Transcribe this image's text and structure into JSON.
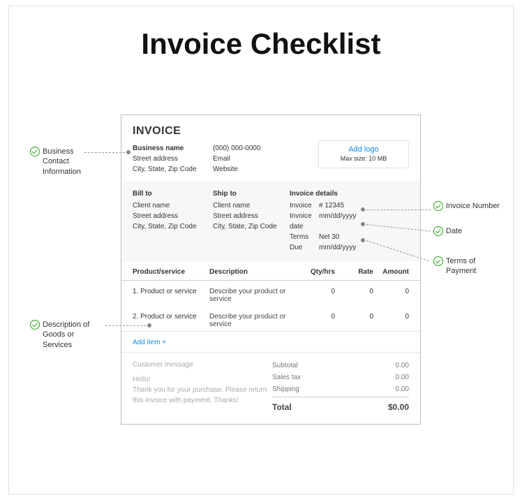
{
  "title": "Invoice Checklist",
  "invoice": {
    "heading": "INVOICE",
    "business": {
      "name": "Business name",
      "street": "Street address",
      "city": "City, State, Zip Code",
      "phone": "(000) 000-0000",
      "email": "Email",
      "website": "Website"
    },
    "logo": {
      "add_label": "Add logo",
      "max_label": "Max size: 10 MB"
    },
    "billto": {
      "label": "Bill to",
      "name": "Client name",
      "street": "Street address",
      "city": "City, State, Zip Code"
    },
    "shipto": {
      "label": "Ship to",
      "name": "Client name",
      "street": "Street address",
      "city": "City, State, Zip Code"
    },
    "details": {
      "label": "Invoice details",
      "invoice_k": "Invoice",
      "invoice_v": "# 12345",
      "date_k": "Invoice date",
      "date_v": "mm/dd/yyyy",
      "terms_k": "Terms",
      "terms_v": "Net 30",
      "due_k": "Due",
      "due_v": "mm/dd/yyyy"
    },
    "columns": {
      "ps": "Product/service",
      "desc": "Description",
      "qty": "Qty/hrs",
      "rate": "Rate",
      "amt": "Amount"
    },
    "rows": [
      {
        "ps": "1. Product or service",
        "desc": "Describe your product or service",
        "qty": "0",
        "rate": "0",
        "amt": "0"
      },
      {
        "ps": "2. Product or service",
        "desc": "Describe your product or service",
        "qty": "0",
        "rate": "0",
        "amt": "0"
      }
    ],
    "add_item": "Add item +",
    "customer_message": {
      "title": "Customer message",
      "body": "Hello!\nThank you for your purchase. Please return this invoice with payment. Thanks!"
    },
    "totals": {
      "subtotal_k": "Subtotal",
      "subtotal_v": "0.00",
      "tax_k": "Sales tax",
      "tax_v": "0.00",
      "ship_k": "Shipping",
      "ship_v": "0.00",
      "total_k": "Total",
      "total_v": "$0.00"
    }
  },
  "annotations": {
    "biz": "Business\nContact\nInformation",
    "goods": "Description of\nGoods or\nServices",
    "number": "Invoice Number",
    "date": "Date",
    "terms": "Terms of\nPayment"
  }
}
